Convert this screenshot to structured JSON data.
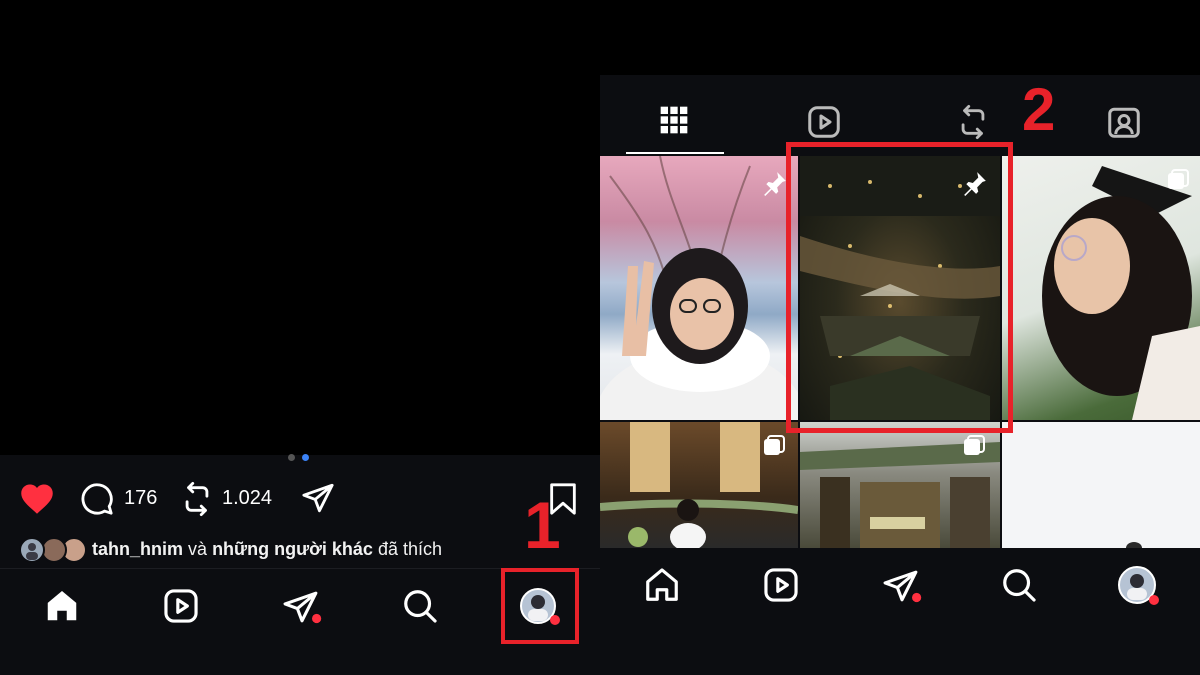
{
  "post": {
    "comment_count": "176",
    "repost_count": "1.024",
    "liked_by_user": "tahn_hnim",
    "liked_connector": "và",
    "liked_others": "những người khác",
    "liked_suffix": "đã thích",
    "carousel_dots": 2,
    "active_dot": 1
  },
  "annotations": {
    "step1": "1",
    "step2": "2"
  },
  "bottom_nav": [
    "home-icon",
    "reels-icon",
    "send-icon",
    "search-icon",
    "profile-avatar"
  ],
  "profile_tabs": [
    "grid-icon",
    "reels-icon",
    "reposts-icon",
    "tagged-icon"
  ],
  "grid_photos": [
    {
      "desc": "girl with scarf under pink blossom tree",
      "pinned": true
    },
    {
      "desc": "night market aerial view",
      "pinned": true
    },
    {
      "desc": "girl in graduation cap",
      "pinned": false,
      "multi": true
    },
    {
      "desc": "girl at café",
      "pinned": false,
      "multi": true
    },
    {
      "desc": "store front",
      "pinned": false,
      "multi": true
    },
    {
      "desc": "white blank photo",
      "pinned": false
    }
  ],
  "colors": {
    "accent_red": "#e8222a",
    "heart_red": "#ff3040",
    "bar_bg": "#0c0d11",
    "dot_active": "#3b82f6"
  }
}
